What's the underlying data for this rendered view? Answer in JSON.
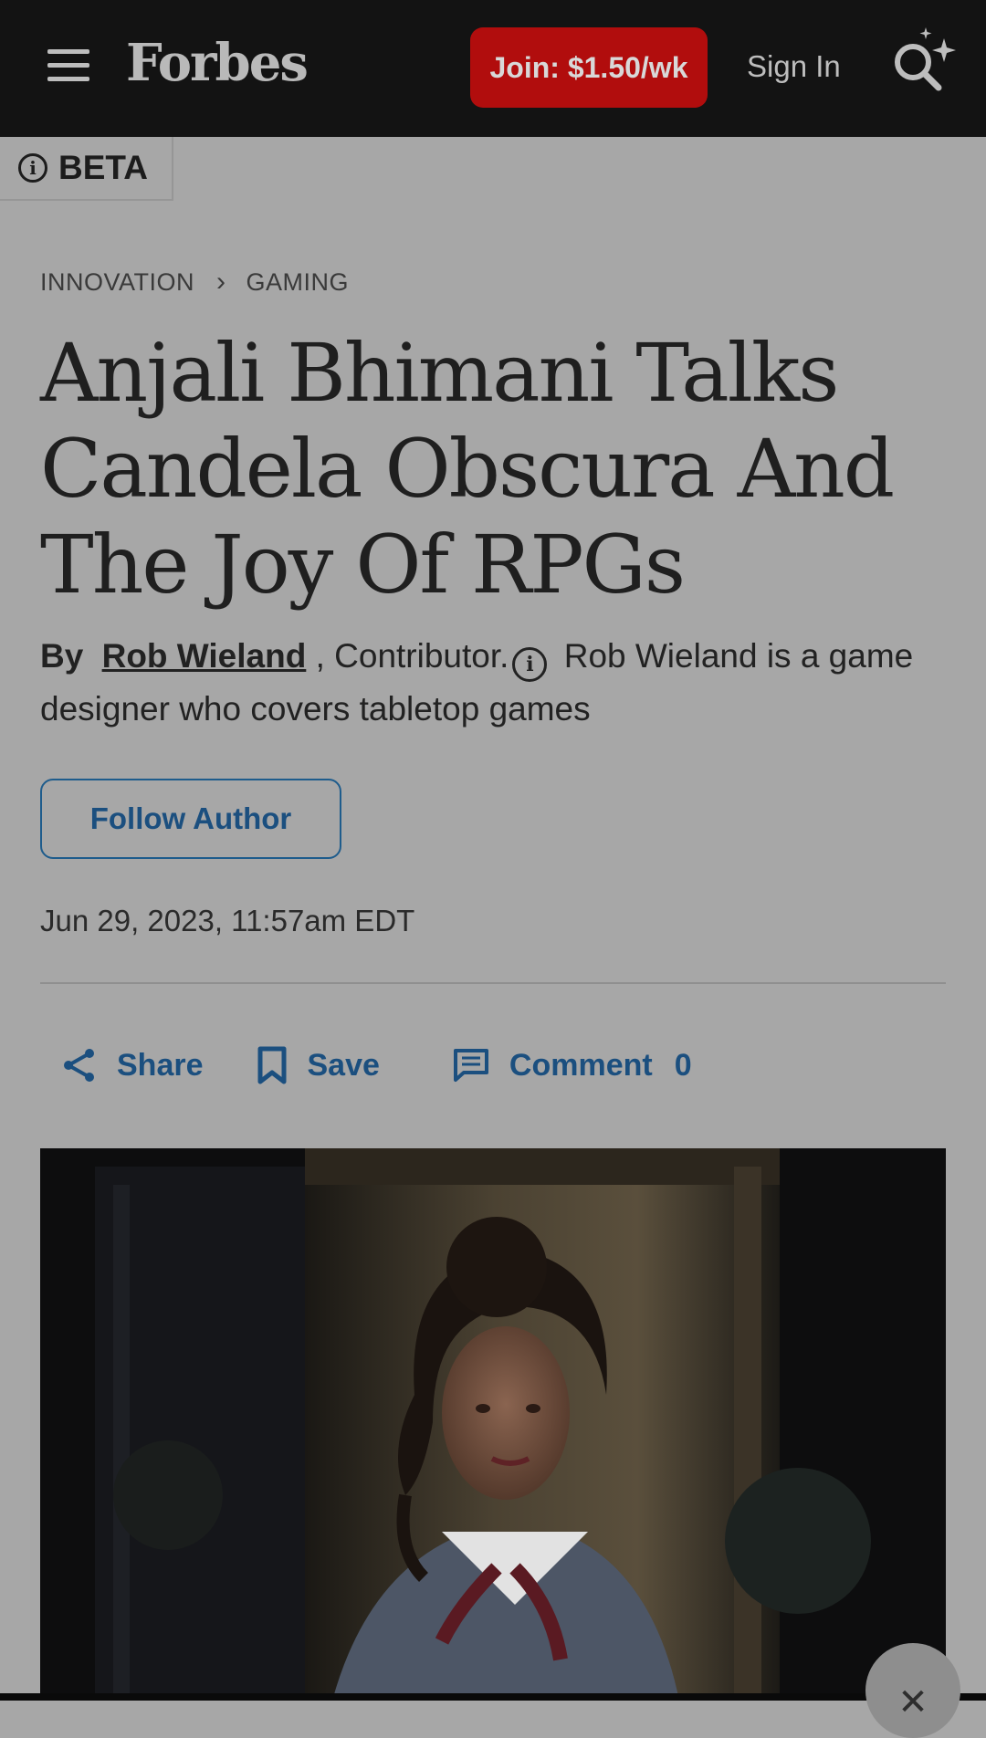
{
  "header": {
    "logo": "Forbes",
    "join_label": "Join: $1.50/wk",
    "signin_label": "Sign In"
  },
  "beta": {
    "label": "BETA"
  },
  "breadcrumb": {
    "section": "INNOVATION",
    "subsection": "GAMING"
  },
  "article": {
    "headline": "Anjali Bhimani Talks Candela Obscura And The Joy Of RPGs",
    "by_label": "By",
    "author": "Rob Wieland",
    "role": ", Contributor.",
    "author_bio": "Rob Wieland is a game designer who covers tabletop games",
    "follow_label": "Follow Author",
    "timestamp": "Jun 29, 2023, 11:57am EDT"
  },
  "actions": {
    "share_label": "Share",
    "save_label": "Save",
    "comment_label": "Comment",
    "comment_count": "0"
  },
  "colors": {
    "topbar": "#131313",
    "accent_red": "#b10d0d",
    "link_blue": "#1b4f7f",
    "overlay_bg": "#a7a7a7"
  }
}
